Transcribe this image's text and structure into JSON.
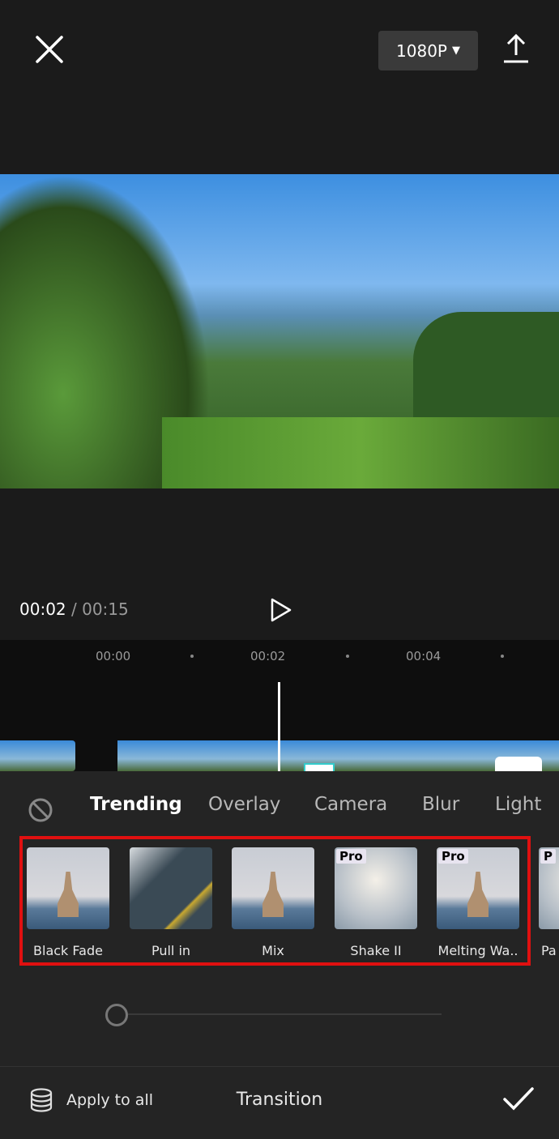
{
  "header": {
    "close_icon": "close-icon",
    "resolution": "1080P",
    "export_icon": "upload-icon"
  },
  "player": {
    "current_time": "00:02",
    "separator": "/",
    "total_time": "00:15",
    "play_icon": "play-icon"
  },
  "timeline": {
    "ticks": [
      "00:00",
      "00:02",
      "00:04"
    ]
  },
  "panel": {
    "none_icon": "prohibited-icon",
    "categories": [
      {
        "label": "Trending",
        "active": true
      },
      {
        "label": "Overlay"
      },
      {
        "label": "Camera"
      },
      {
        "label": "Blur"
      },
      {
        "label": "Light"
      }
    ],
    "transitions": [
      {
        "label": "Black Fade"
      },
      {
        "label": "Pull in"
      },
      {
        "label": "Mix"
      },
      {
        "label": "Shake II",
        "badge": "Pro"
      },
      {
        "label": "Melting Wa..",
        "badge": "Pro"
      },
      {
        "label": "Pa",
        "badge": "P"
      }
    ],
    "highlight_color": "#e01010",
    "duration_slider": 0
  },
  "footer": {
    "apply_all": "Apply to all",
    "title": "Transition",
    "confirm_icon": "check-icon"
  }
}
